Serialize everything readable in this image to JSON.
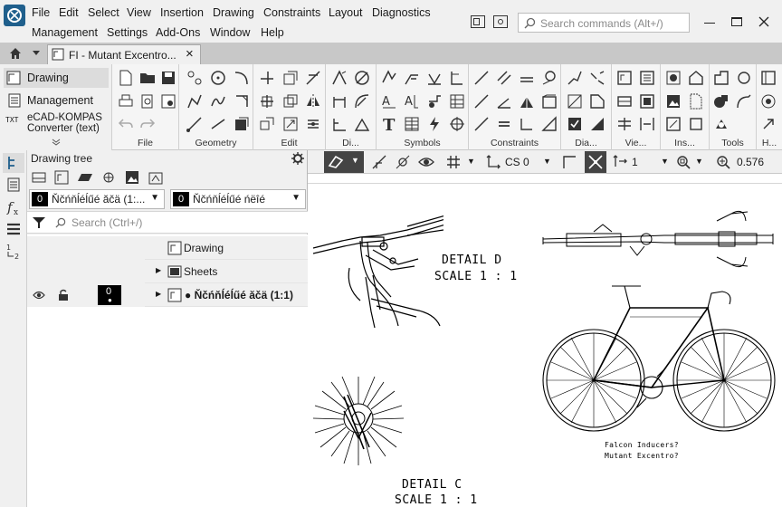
{
  "menubar": {
    "row1": [
      "File",
      "Edit",
      "Select",
      "View",
      "Insertion",
      "Drawing",
      "Constraints",
      "Layout",
      "Diagnostics"
    ],
    "row2": [
      "Management",
      "Settings",
      "Add-Ons",
      "Window",
      "Help"
    ],
    "search_placeholder": "Search commands (Alt+/)"
  },
  "tabbar": {
    "doc_tab_label": "FI - Mutant Excentro...",
    "close_glyph": "×"
  },
  "ribbon": {
    "left_items": [
      "Drawing",
      "Management",
      "eCAD-KOMPAS Converter (text)"
    ],
    "groups": [
      "File",
      "Geometry",
      "Edit",
      "Di...",
      "Symbols",
      "Constraints",
      "Dia...",
      "Vie...",
      "Ins...",
      "Tools",
      "H..."
    ]
  },
  "tree": {
    "title": "Drawing tree",
    "layer_dropdown": {
      "num": "0",
      "text": "Ňčńňĺéĺűé ăčä (1:..."
    },
    "state_dropdown": {
      "num": "0",
      "text": "Ňčńňĺéĺűé ńëîé"
    },
    "search_placeholder": "Search (Ctrl+/)",
    "nodes": [
      {
        "label": "Drawing"
      },
      {
        "label": "Sheets"
      },
      {
        "label": "● Ňčńňĺéĺűé ăčä (1:1)",
        "num": "0"
      }
    ]
  },
  "canvas_toolbar": {
    "cs_label": "CS 0",
    "step_value": "1",
    "zoom_value": "0.576"
  },
  "drawing": {
    "detail_d_title": "DETAIL D",
    "detail_d_scale": "SCALE 1 : 1",
    "detail_c_title": "DETAIL C",
    "detail_c_scale": "SCALE 1 : 1",
    "note_line1": "Falcon Inducers?",
    "note_line2": "Mutant Excentro?"
  },
  "colors": {
    "accent": "#1f5f8c",
    "tab_bg": "#c8c8c8",
    "canvas": "#ffffff"
  }
}
